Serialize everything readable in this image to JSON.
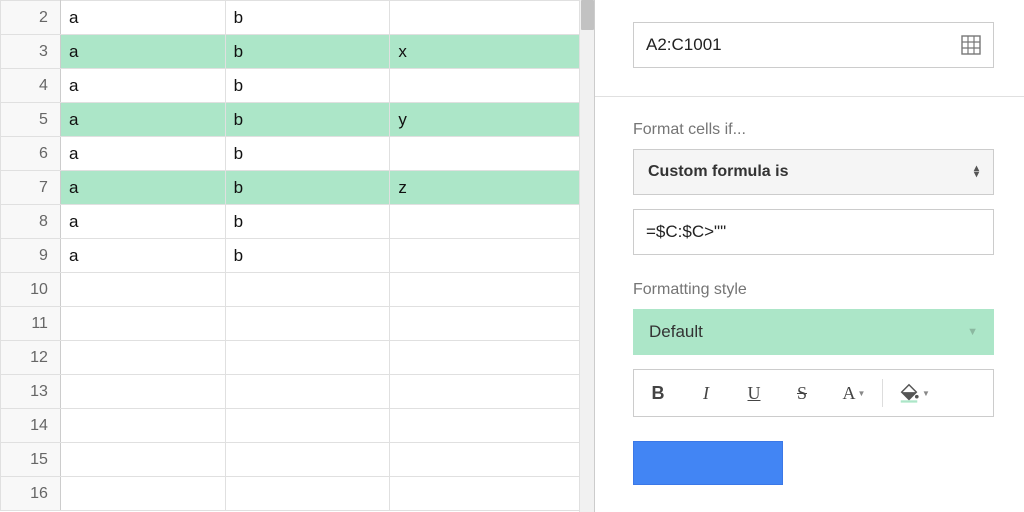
{
  "sheet": {
    "rows": [
      {
        "num": "2",
        "a": "a",
        "b": "b",
        "c": "",
        "hl": false
      },
      {
        "num": "3",
        "a": "a",
        "b": "b",
        "c": "x",
        "hl": true
      },
      {
        "num": "4",
        "a": "a",
        "b": "b",
        "c": "",
        "hl": false
      },
      {
        "num": "5",
        "a": "a",
        "b": "b",
        "c": "y",
        "hl": true
      },
      {
        "num": "6",
        "a": "a",
        "b": "b",
        "c": "",
        "hl": false
      },
      {
        "num": "7",
        "a": "a",
        "b": "b",
        "c": "z",
        "hl": true
      },
      {
        "num": "8",
        "a": "a",
        "b": "b",
        "c": "",
        "hl": false
      },
      {
        "num": "9",
        "a": "a",
        "b": "b",
        "c": "",
        "hl": false
      },
      {
        "num": "10",
        "a": "",
        "b": "",
        "c": "",
        "hl": false
      },
      {
        "num": "11",
        "a": "",
        "b": "",
        "c": "",
        "hl": false
      },
      {
        "num": "12",
        "a": "",
        "b": "",
        "c": "",
        "hl": false
      },
      {
        "num": "13",
        "a": "",
        "b": "",
        "c": "",
        "hl": false
      },
      {
        "num": "14",
        "a": "",
        "b": "",
        "c": "",
        "hl": false
      },
      {
        "num": "15",
        "a": "",
        "b": "",
        "c": "",
        "hl": false
      },
      {
        "num": "16",
        "a": "",
        "b": "",
        "c": "",
        "hl": false
      }
    ]
  },
  "sidebar": {
    "range_value": "A2:C1001",
    "format_if_label": "Format cells if...",
    "condition_selected": "Custom formula is",
    "formula_value": "=$C:$C>\"\"",
    "formatting_style_label": "Formatting style",
    "style_selected": "Default",
    "toolbar": {
      "bold": "B",
      "italic": "I",
      "underline": "U",
      "strike": "S",
      "textcolor": "A"
    }
  }
}
